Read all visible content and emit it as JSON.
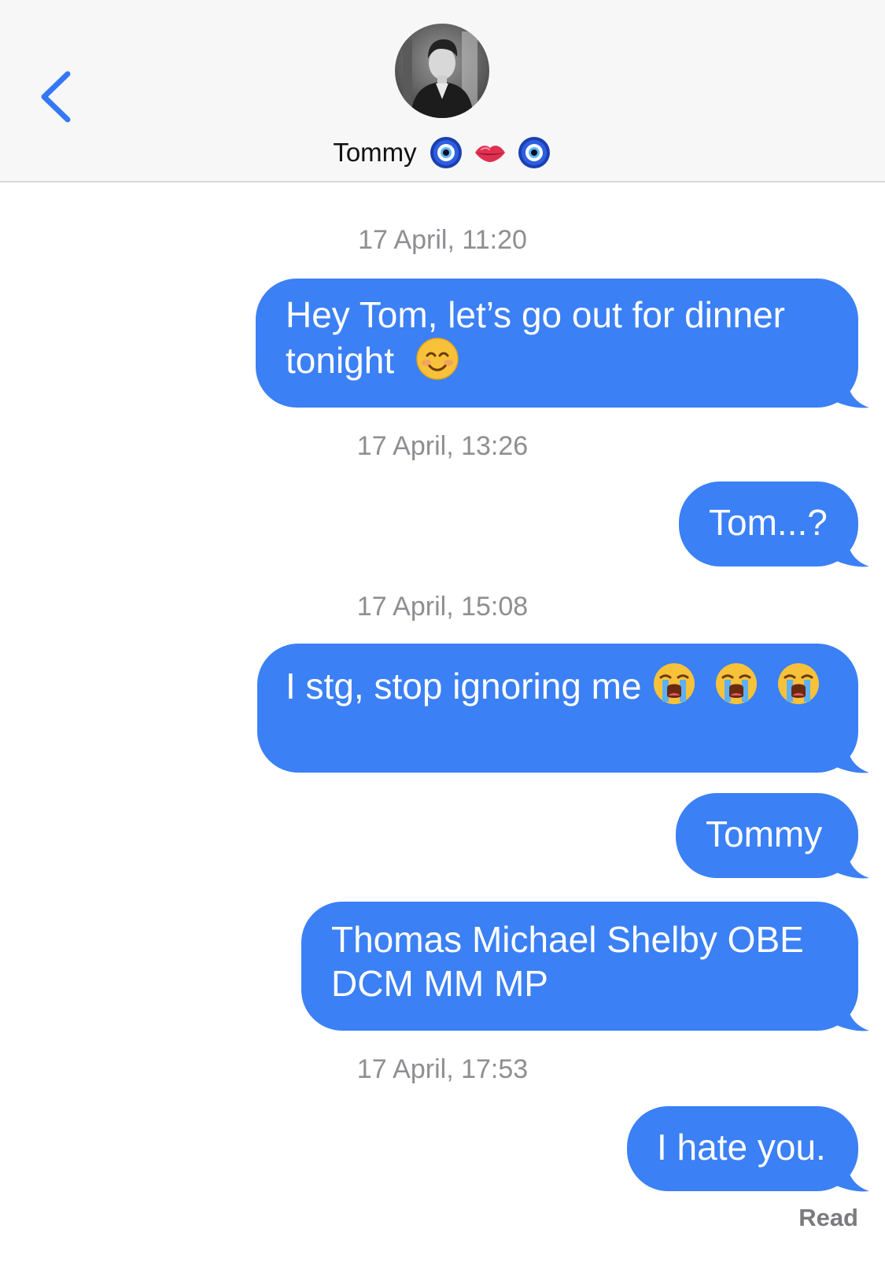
{
  "header": {
    "contact_name": "Tommy",
    "avatar_alt": "Tommy",
    "contact_icons": [
      "nazar-amulet-icon",
      "lips-icon",
      "nazar-amulet-icon"
    ]
  },
  "thread": {
    "timestamps": [
      "17 April, 11:20",
      "17 April, 13:26",
      "17 April, 15:08",
      "17 April, 17:53"
    ],
    "messages": [
      {
        "line1": "Hey Tom, let’s go out for dinner",
        "line2": "tonight",
        "emoji": [
          "smiling-face-icon"
        ]
      },
      {
        "text": "Tom...?"
      },
      {
        "text": "I stg, stop ignoring me",
        "emoji": [
          "loudly-crying-face-icon",
          "loudly-crying-face-icon",
          "loudly-crying-face-icon"
        ]
      },
      {
        "text": "Tommy"
      },
      {
        "line1": "Thomas Michael Shelby OBE",
        "line2": "DCM MM MP"
      },
      {
        "text": "I hate you."
      }
    ],
    "read_receipt": "Read"
  },
  "colors": {
    "bubble": "#3b80f5",
    "accent": "#3478f6",
    "header_bg": "#f7f7f7",
    "timestamp": "#8e8e93"
  }
}
